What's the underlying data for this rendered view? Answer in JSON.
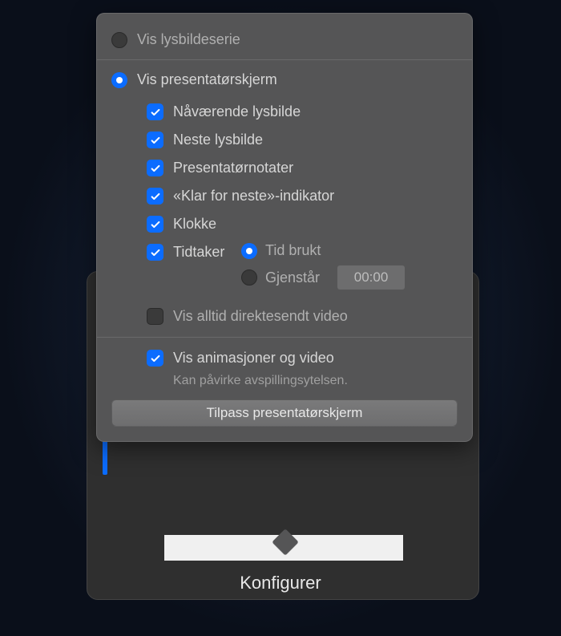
{
  "footer": {
    "configure": "Konfigurer"
  },
  "radios": {
    "slideshow": "Vis lysbildeserie",
    "presenter": "Vis presentatørskjerm"
  },
  "checks": {
    "current": "Nåværende lysbilde",
    "next": "Neste lysbilde",
    "notes": "Presentatørnotater",
    "ready": "«Klar for neste»-indikator",
    "clock": "Klokke",
    "timer": "Tidtaker",
    "live": "Vis alltid direktesendt video",
    "anim": "Vis animasjoner og video"
  },
  "timer": {
    "elapsed": "Tid brukt",
    "remaining": "Gjenstår",
    "value": "00:00"
  },
  "hint": "Kan påvirke avspillingsytelsen.",
  "button": "Tilpass presentatørskjerm"
}
